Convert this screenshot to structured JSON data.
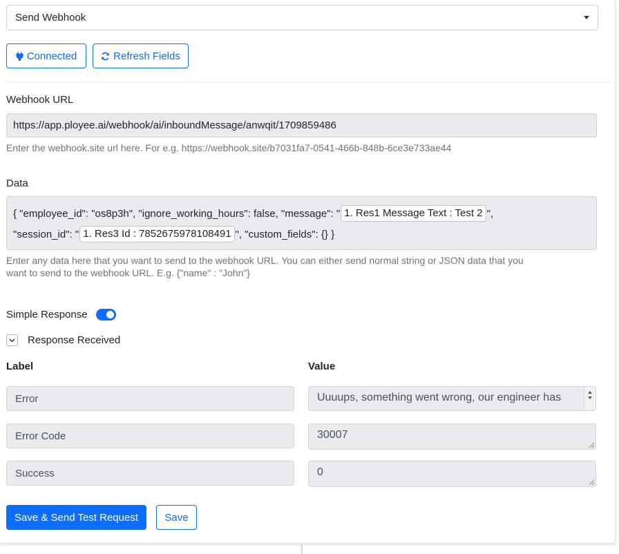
{
  "action_select": {
    "value": "Send Webhook"
  },
  "buttons": {
    "connected_label": "Connected",
    "refresh_label": "Refresh Fields",
    "save_send_label": "Save & Send Test Request",
    "save_label": "Save"
  },
  "webhook": {
    "label": "Webhook URL",
    "value": "https://app.ployee.ai/webhook/ai/inboundMessage/anwqit/1709859486",
    "help": "Enter the webhook.site url here. For e.g. https://webhook.site/b7031fa7-0541-466b-848b-6ce3e733ae44"
  },
  "data_field": {
    "label": "Data",
    "line1_pre": "{ \"employee_id\": \"os8p3h\", \"ignore_working_hours\": false, \"message\": \"",
    "line1_pill": "1. Res1 Message Text : Test 2",
    "line1_post": "\",",
    "line2_pre": "\"session_id\": \"",
    "line2_pill": "1. Res3 Id : 7852675978108491",
    "line2_post": "\", \"custom_fields\": {} }",
    "help_line1": "Enter any data here that you want to send to the webhook URL. You can either send normal string or JSON data that you",
    "help_line2": "want to send to the webhook URL. E.g. {\"name\" : \"John\"}"
  },
  "simple_response": {
    "label": "Simple Response",
    "enabled": true
  },
  "response_received": {
    "label": "Response Received"
  },
  "response_table": {
    "label_header": "Label",
    "value_header": "Value",
    "rows": [
      {
        "label": "Error",
        "value": "Uuuups, something went wrong, our engineer has"
      },
      {
        "label": "Error Code",
        "value": "30007"
      },
      {
        "label": "Success",
        "value": "0"
      }
    ]
  },
  "colors": {
    "primary": "#0d6efd",
    "field_bg": "#e9ecef",
    "help_text": "#6c757d"
  },
  "icons": {
    "connected": "plug-icon",
    "refresh": "refresh-icon",
    "collapse": "chevron-down-icon"
  }
}
